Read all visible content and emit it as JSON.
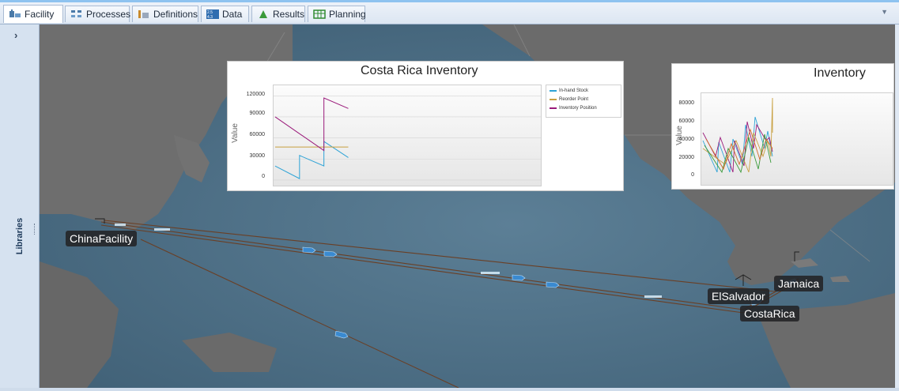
{
  "tabs": [
    {
      "label": "Facility",
      "icon": "facility-icon",
      "color": "#4a7aa8"
    },
    {
      "label": "Processes",
      "icon": "processes-icon",
      "color": "#4a7aa8"
    },
    {
      "label": "Definitions",
      "icon": "definitions-icon",
      "color": "#c98a2c"
    },
    {
      "label": "Data",
      "icon": "data-icon",
      "color": "#2f6db0"
    },
    {
      "label": "Results",
      "icon": "results-icon",
      "color": "#3a9a3a"
    },
    {
      "label": "Planning",
      "icon": "planning-icon",
      "color": "#2f8a2f"
    }
  ],
  "sidebar": {
    "expand_glyph": "›",
    "libraries_label": "Libraries"
  },
  "map": {
    "nodes": {
      "china": "ChinaFacility",
      "elsalvador": "ElSalvador",
      "costarica": "CostaRica",
      "jamaica": "Jamaica"
    },
    "colors": {
      "ocean": "#4a6e86",
      "land": "#6a6a6a",
      "route": "#7a4a2a",
      "ship": "#3a8ad0"
    }
  },
  "chart_data": [
    {
      "type": "line",
      "title": "Costa Rica Inventory",
      "ylabel": "Value",
      "ylim": [
        -8000,
        135000
      ],
      "yticks": [
        "120000",
        "90000",
        "60000",
        "30000",
        "0"
      ],
      "legend": "top-right",
      "series": [
        {
          "name": "In-hand Stock",
          "color": "#2ea3d6",
          "x": [
            0,
            0,
            0.6,
            0.6,
            1.2,
            1.2,
            1.8
          ],
          "values": [
            20000,
            20000,
            2000,
            35000,
            20000,
            55000,
            32000
          ]
        },
        {
          "name": "Reorder Point",
          "color": "#c8a040",
          "x": [
            0,
            1.8
          ],
          "values": [
            47000,
            47000
          ]
        },
        {
          "name": "Inventory Position",
          "color": "#9a1a7a",
          "x": [
            0,
            0,
            1.2,
            1.2,
            1.8
          ],
          "values": [
            90000,
            90000,
            42000,
            117000,
            102000
          ]
        }
      ]
    },
    {
      "type": "line",
      "title": "Inventory",
      "ylabel": "Value",
      "yticks": [
        "80000",
        "60000",
        "40000",
        "20000",
        "0"
      ]
    }
  ]
}
